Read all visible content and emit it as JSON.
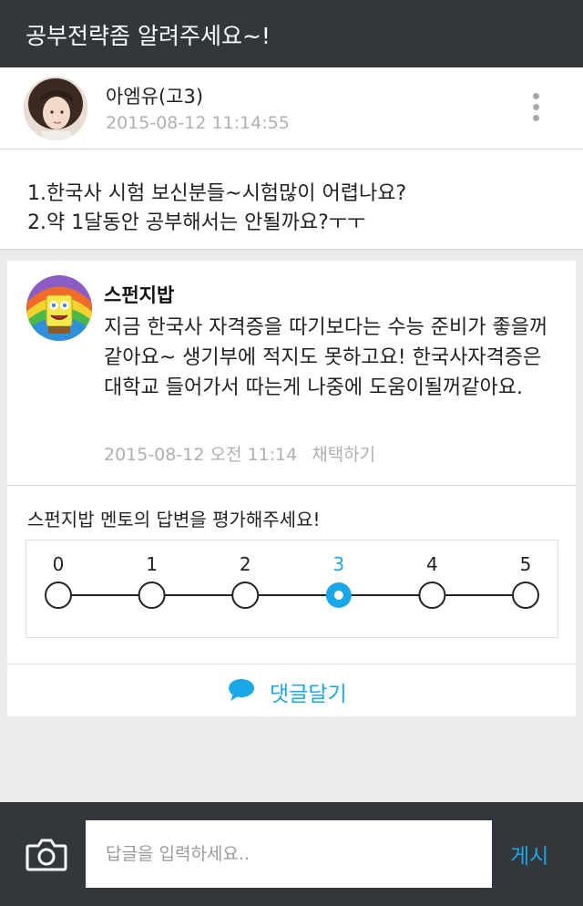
{
  "header": {
    "title": "공부전략좀 알려주세요~!"
  },
  "post": {
    "author": "아엠유(고3)",
    "timestamp": "2015-08-12 11:14:55",
    "lines": [
      "1.한국사 시험 보신분들~시험많이 어렵나요?",
      "2.약 1달동안 공부해서는 안될까요?ㅜㅜ"
    ]
  },
  "answer": {
    "mentor": "스펀지밥",
    "body": "지금 한국사 자격증을 따기보다는 수능 준비가 좋을꺼 같아요~ 생기부에 적지도 못하고요! 한국사자격증은 대학교 들어가서 따는게 나중에 도움이될꺼같아요.",
    "timestamp": "2015-08-12 오전 11:14",
    "adopt_label": "채택하기",
    "rating_title": "스펀지밥 멘토의 답변을 평가해주세요!",
    "rating_scale": [
      "0",
      "1",
      "2",
      "3",
      "4",
      "5"
    ],
    "rating_selected": 3,
    "comment_label": "댓글달기"
  },
  "reply_bar": {
    "placeholder": "답글을 입력하세요..",
    "post_label": "게시"
  },
  "colors": {
    "accent": "#1aa7e8",
    "dark_bar": "#33373b",
    "muted_text": "#b0b0b0"
  },
  "icons": {
    "more": "kebab-icon",
    "comment": "speech-bubble-icon",
    "camera": "camera-icon"
  }
}
